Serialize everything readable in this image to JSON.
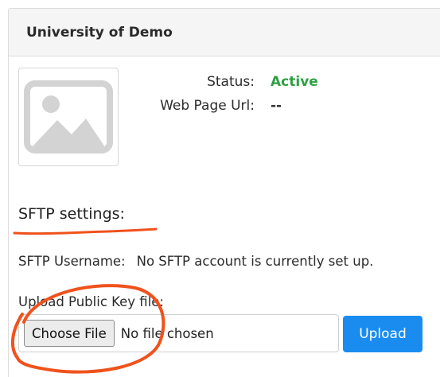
{
  "panel": {
    "title": "University of Demo"
  },
  "info": {
    "status_label": "Status:",
    "status_value": "Active",
    "url_label": "Web Page Url:",
    "url_value": "--"
  },
  "sftp": {
    "heading": "SFTP settings:",
    "username_label": "SFTP Username:",
    "username_value": "No SFTP account is currently set up.",
    "upload_label": "Upload Public Key file:",
    "choose_button": "Choose File",
    "no_file_text": "No file chosen",
    "upload_button": "Upload"
  },
  "icons": {
    "logo_placeholder": "image-placeholder-icon"
  },
  "colors": {
    "status_active": "#2ea043",
    "upload_button": "#1a8cf0",
    "annotation": "#f0521c"
  }
}
